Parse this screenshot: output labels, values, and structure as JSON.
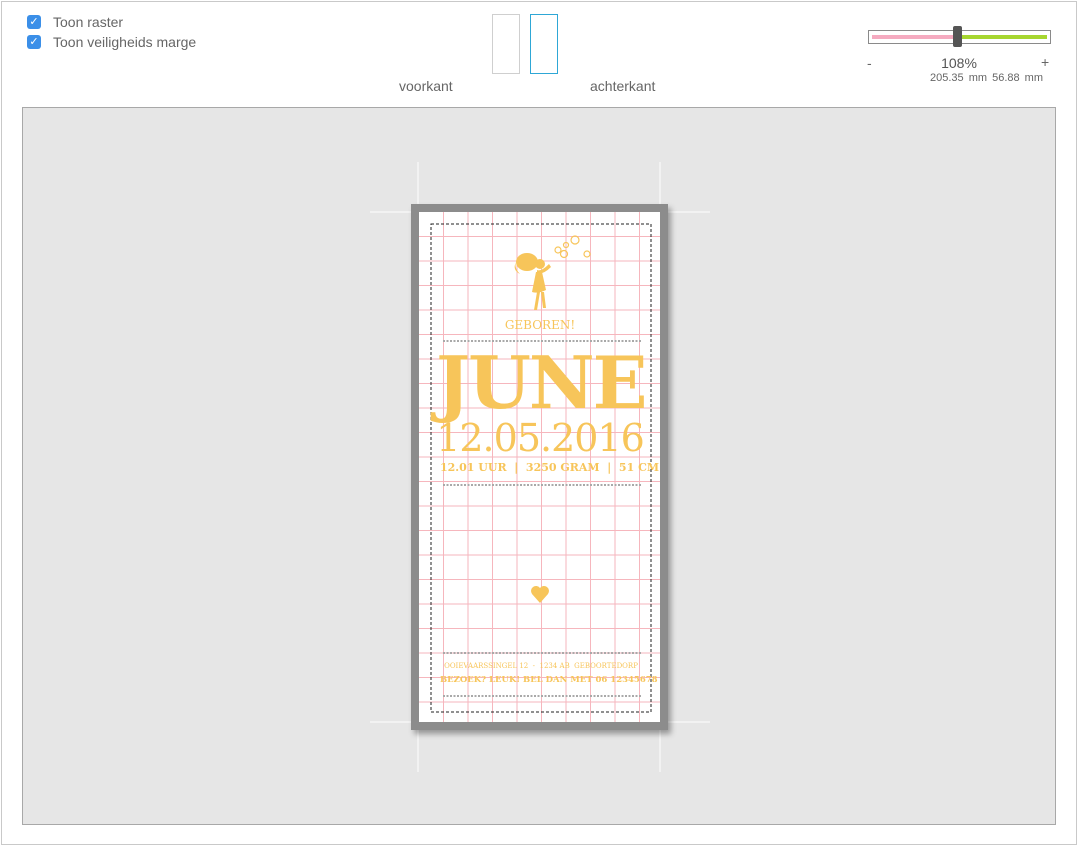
{
  "options": {
    "show_grid": {
      "label": "Toon raster",
      "checked": true
    },
    "show_margin": {
      "label": "Toon veiligheids marge",
      "checked": true
    }
  },
  "sides": {
    "front_label": "voorkant",
    "back_label": "achterkant",
    "selected": "achterkant"
  },
  "zoom": {
    "minus": "-",
    "plus": "+",
    "percent": "108%",
    "width": "205.35 mm",
    "height": "56.88 mm",
    "level": 0.49
  },
  "card": {
    "heading": "GEBOREN!",
    "name": "JUNE",
    "date": "12.05.2016",
    "details": "12.01 UUR  |  3250 GRAM  |  51 CM",
    "address": "OOIEVAARSSINGEL 12  -  1234 AB  GEBOORTEDORP",
    "visit": "BEZOEK? LEUK! BEL DAN MET 06 12345678",
    "accent_color": "#f7c55a",
    "grid_color": "#f6b6bd",
    "icons": [
      "girl-blowing-bubbles-icon",
      "heart-icon"
    ]
  }
}
